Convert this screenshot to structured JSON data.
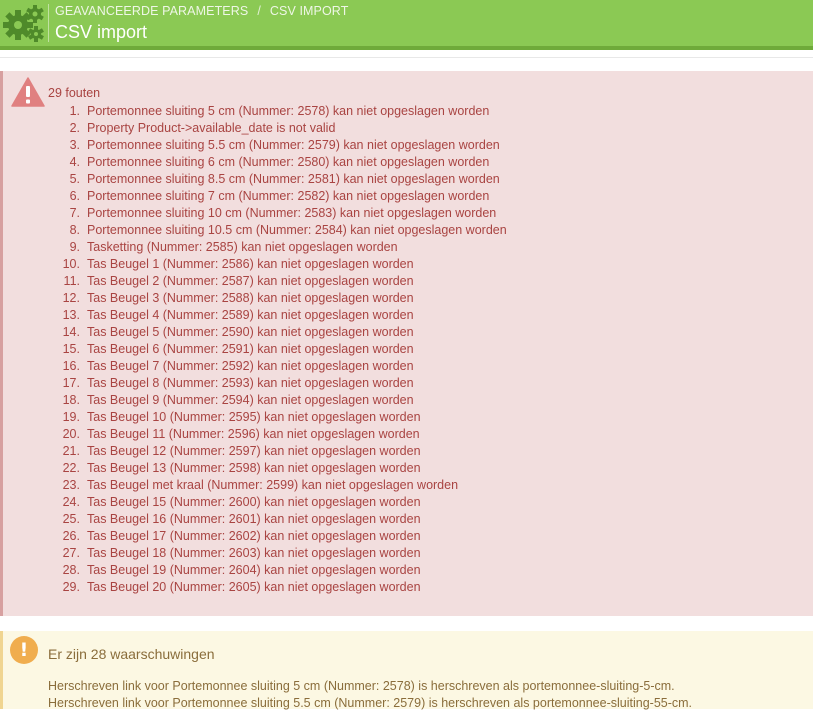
{
  "toolbar": {
    "breadcrumb": [
      "GEAVANCEERDE PARAMETERS",
      "CSV IMPORT"
    ],
    "title": "CSV import",
    "icon": "gears-icon",
    "color": "#8bc954"
  },
  "errors": {
    "heading": "29 fouten",
    "icon": "warning-triangle-icon",
    "color": "#a94442",
    "items": [
      {
        "num": "1.",
        "text": "Portemonnee sluiting 5 cm (Nummer: 2578) kan niet opgeslagen worden"
      },
      {
        "num": "2.",
        "text": "Property Product->available_date is not valid"
      },
      {
        "num": "3.",
        "text": "Portemonnee sluiting 5.5 cm (Nummer: 2579) kan niet opgeslagen worden"
      },
      {
        "num": "4.",
        "text": "Portemonnee sluiting 6 cm (Nummer: 2580) kan niet opgeslagen worden"
      },
      {
        "num": "5.",
        "text": "Portemonnee sluiting 8.5 cm (Nummer: 2581) kan niet opgeslagen worden"
      },
      {
        "num": "6.",
        "text": "Portemonnee sluiting 7 cm (Nummer: 2582) kan niet opgeslagen worden"
      },
      {
        "num": "7.",
        "text": "Portemonnee sluiting 10 cm (Nummer: 2583) kan niet opgeslagen worden"
      },
      {
        "num": "8.",
        "text": "Portemonnee sluiting 10.5 cm (Nummer: 2584) kan niet opgeslagen worden"
      },
      {
        "num": "9.",
        "text": "Tasketting (Nummer: 2585) kan niet opgeslagen worden"
      },
      {
        "num": "10.",
        "text": "Tas Beugel 1 (Nummer: 2586) kan niet opgeslagen worden"
      },
      {
        "num": "11.",
        "text": "Tas Beugel 2 (Nummer: 2587) kan niet opgeslagen worden"
      },
      {
        "num": "12.",
        "text": "Tas Beugel 3 (Nummer: 2588) kan niet opgeslagen worden"
      },
      {
        "num": "13.",
        "text": "Tas Beugel 4 (Nummer: 2589) kan niet opgeslagen worden"
      },
      {
        "num": "14.",
        "text": "Tas Beugel 5 (Nummer: 2590) kan niet opgeslagen worden"
      },
      {
        "num": "15.",
        "text": "Tas Beugel 6 (Nummer: 2591) kan niet opgeslagen worden"
      },
      {
        "num": "16.",
        "text": "Tas Beugel 7 (Nummer: 2592) kan niet opgeslagen worden"
      },
      {
        "num": "17.",
        "text": "Tas Beugel 8 (Nummer: 2593) kan niet opgeslagen worden"
      },
      {
        "num": "18.",
        "text": "Tas Beugel 9 (Nummer: 2594) kan niet opgeslagen worden"
      },
      {
        "num": "19.",
        "text": "Tas Beugel 10 (Nummer: 2595) kan niet opgeslagen worden"
      },
      {
        "num": "20.",
        "text": "Tas Beugel 11 (Nummer: 2596) kan niet opgeslagen worden"
      },
      {
        "num": "21.",
        "text": "Tas Beugel 12 (Nummer: 2597) kan niet opgeslagen worden"
      },
      {
        "num": "22.",
        "text": "Tas Beugel 13 (Nummer: 2598) kan niet opgeslagen worden"
      },
      {
        "num": "23.",
        "text": "Tas Beugel met kraal (Nummer: 2599) kan niet opgeslagen worden"
      },
      {
        "num": "24.",
        "text": "Tas Beugel 15 (Nummer: 2600) kan niet opgeslagen worden"
      },
      {
        "num": "25.",
        "text": "Tas Beugel 16 (Nummer: 2601) kan niet opgeslagen worden"
      },
      {
        "num": "26.",
        "text": "Tas Beugel 17 (Nummer: 2602) kan niet opgeslagen worden"
      },
      {
        "num": "27.",
        "text": "Tas Beugel 18 (Nummer: 2603) kan niet opgeslagen worden"
      },
      {
        "num": "28.",
        "text": "Tas Beugel 19 (Nummer: 2604) kan niet opgeslagen worden"
      },
      {
        "num": "29.",
        "text": "Tas Beugel 20 (Nummer: 2605) kan niet opgeslagen worden"
      }
    ]
  },
  "warnings": {
    "heading": "Er zijn 28 waarschuwingen",
    "icon": "exclamation-circle-icon",
    "icon_glyph": "!",
    "color": "#8a6d3b",
    "lines": [
      "Herschreven link voor Portemonnee sluiting 5 cm (Nummer: 2578) is herschreven als portemonnee-sluiting-5-cm.",
      "Herschreven link voor Portemonnee sluiting 5.5 cm (Nummer: 2579) is herschreven als portemonnee-sluiting-55-cm."
    ]
  }
}
